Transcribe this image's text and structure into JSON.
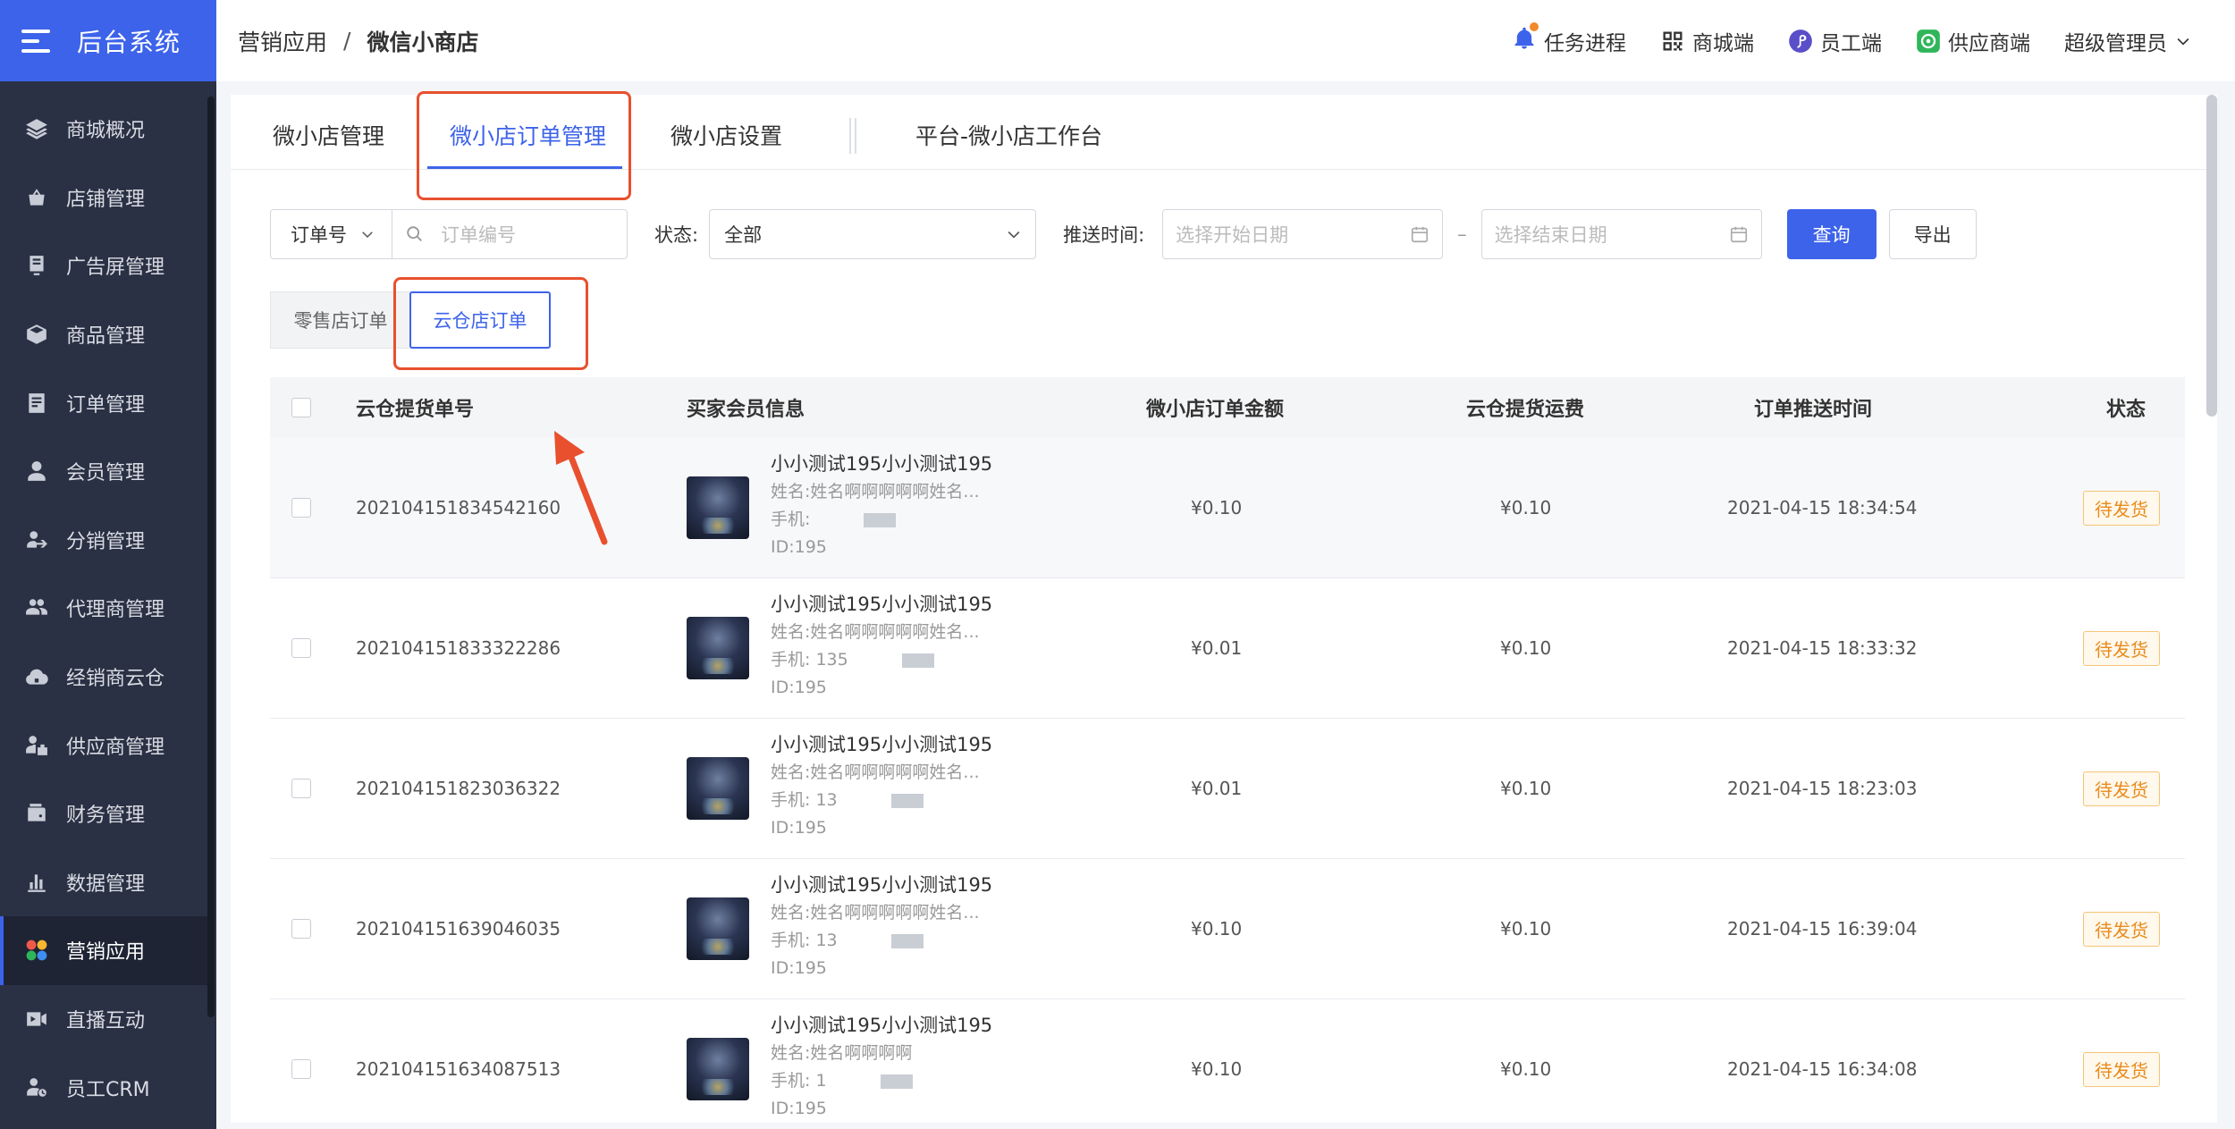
{
  "app": {
    "title": "后台系统"
  },
  "sidebar": {
    "items": [
      {
        "label": "商城概况",
        "icon": "layers-icon"
      },
      {
        "label": "店铺管理",
        "icon": "shop-basket-icon"
      },
      {
        "label": "广告屏管理",
        "icon": "screen-icon"
      },
      {
        "label": "商品管理",
        "icon": "box-icon"
      },
      {
        "label": "订单管理",
        "icon": "order-list-icon"
      },
      {
        "label": "会员管理",
        "icon": "user-icon"
      },
      {
        "label": "分销管理",
        "icon": "distribution-icon"
      },
      {
        "label": "代理商管理",
        "icon": "agents-icon"
      },
      {
        "label": "经销商云仓",
        "icon": "cloud-warehouse-icon"
      },
      {
        "label": "供应商管理",
        "icon": "supplier-icon"
      },
      {
        "label": "财务管理",
        "icon": "wallet-icon"
      },
      {
        "label": "数据管理",
        "icon": "bar-chart-icon"
      },
      {
        "label": "营销应用",
        "icon": "apps-grid-icon",
        "active": true
      },
      {
        "label": "直播互动",
        "icon": "video-icon"
      },
      {
        "label": "员工CRM",
        "icon": "crm-icon"
      }
    ]
  },
  "header": {
    "breadcrumb": [
      "营销应用",
      "/",
      "微信小商店"
    ],
    "links": {
      "task": "任务进程",
      "mall": "商城端",
      "staff": "员工端",
      "supplier": "供应商端",
      "user": "超级管理员"
    }
  },
  "tabs": [
    "微小店管理",
    "微小店订单管理",
    "微小店设置",
    "平台-微小店工作台"
  ],
  "filter": {
    "order_type": "订单号",
    "order_placeholder": "订单编号",
    "status_label": "状态:",
    "status_value": "全部",
    "push_time_label": "推送时间:",
    "start_placeholder": "选择开始日期",
    "dash": "–",
    "end_placeholder": "选择结束日期",
    "query": "查询",
    "export": "导出"
  },
  "subtabs": [
    "零售店订单",
    "云仓店订单"
  ],
  "table": {
    "headers": [
      "云仓提货单号",
      "买家会员信息",
      "微小店订单金额",
      "云仓提货运费",
      "订单推送时间",
      "状态"
    ],
    "rows": [
      {
        "id": "202104151834542160",
        "name": "小小测试195小小测试195",
        "realname": "姓名:姓名啊啊啊啊啊姓名...",
        "phone": "手机:",
        "uid": "ID:195",
        "amount": "¥0.10",
        "freight": "¥0.10",
        "time": "2021-04-15 18:34:54",
        "status": "待发货"
      },
      {
        "id": "202104151833322286",
        "name": "小小测试195小小测试195",
        "realname": "姓名:姓名啊啊啊啊啊姓名...",
        "phone": "手机: 135",
        "uid": "ID:195",
        "amount": "¥0.01",
        "freight": "¥0.10",
        "time": "2021-04-15 18:33:32",
        "status": "待发货"
      },
      {
        "id": "202104151823036322",
        "name": "小小测试195小小测试195",
        "realname": "姓名:姓名啊啊啊啊啊姓名...",
        "phone": "手机: 13",
        "uid": "ID:195",
        "amount": "¥0.01",
        "freight": "¥0.10",
        "time": "2021-04-15 18:23:03",
        "status": "待发货"
      },
      {
        "id": "202104151639046035",
        "name": "小小测试195小小测试195",
        "realname": "姓名:姓名啊啊啊啊啊姓名...",
        "phone": "手机: 13",
        "uid": "ID:195",
        "amount": "¥0.10",
        "freight": "¥0.10",
        "time": "2021-04-15 16:39:04",
        "status": "待发货"
      },
      {
        "id": "202104151634087513",
        "name": "小小测试195小小测试195",
        "realname": "姓名:姓名啊啊啊啊",
        "phone": "手机: 1",
        "uid": "ID:195",
        "amount": "¥0.10",
        "freight": "¥0.10",
        "time": "2021-04-15 16:34:08",
        "status": "待发货"
      }
    ]
  },
  "colors": {
    "primary": "#3d63ea",
    "sidebar": "#2a3144",
    "annotation": "#e8502e",
    "pending": "#e88b1c"
  }
}
